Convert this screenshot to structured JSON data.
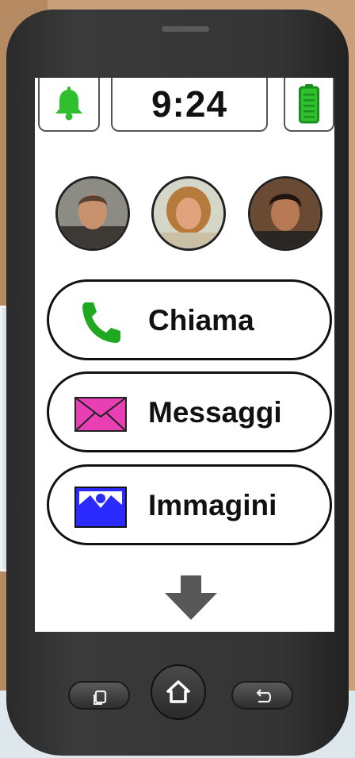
{
  "status_bar": {
    "time": "9:24",
    "notification_icon": "bell-icon",
    "battery_icon": "battery-icon",
    "accent_green": "#2fbf2f"
  },
  "contacts": [
    {
      "name": "contact-1",
      "icon": "avatar"
    },
    {
      "name": "contact-2",
      "icon": "avatar"
    },
    {
      "name": "contact-3",
      "icon": "avatar"
    }
  ],
  "actions": [
    {
      "label": "Chiama",
      "icon": "phone-icon",
      "color": "#21a821"
    },
    {
      "label": "Messaggi",
      "icon": "envelope-icon",
      "color": "#e83fb4"
    },
    {
      "label": "Immagini",
      "icon": "picture-icon",
      "color": "#2b2bff"
    }
  ],
  "more_icon": "arrow-down-icon",
  "nav": {
    "recent_icon": "recent-apps-icon",
    "home_icon": "home-icon",
    "back_icon": "back-icon"
  }
}
